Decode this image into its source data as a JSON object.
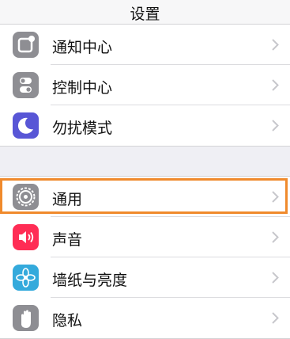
{
  "header": {
    "title": "设置"
  },
  "group1": [
    {
      "label": "通知中心",
      "icon": "notification-center-icon",
      "color": "#8e8e93"
    },
    {
      "label": "控制中心",
      "icon": "control-center-icon",
      "color": "#8e8e93"
    },
    {
      "label": "勿扰模式",
      "icon": "moon-icon",
      "color": "#5856d6"
    }
  ],
  "group2": [
    {
      "label": "通用",
      "icon": "gear-icon",
      "color": "#8e8e93",
      "highlighted": true
    },
    {
      "label": "声音",
      "icon": "speaker-icon",
      "color": "#ff2d55"
    },
    {
      "label": "墙纸与亮度",
      "icon": "flower-icon",
      "color": "#34aadc"
    },
    {
      "label": "隐私",
      "icon": "hand-icon",
      "color": "#8e8e93"
    }
  ],
  "colors": {
    "highlight": "#f08a2c",
    "chevron": "#c7c7cc"
  }
}
